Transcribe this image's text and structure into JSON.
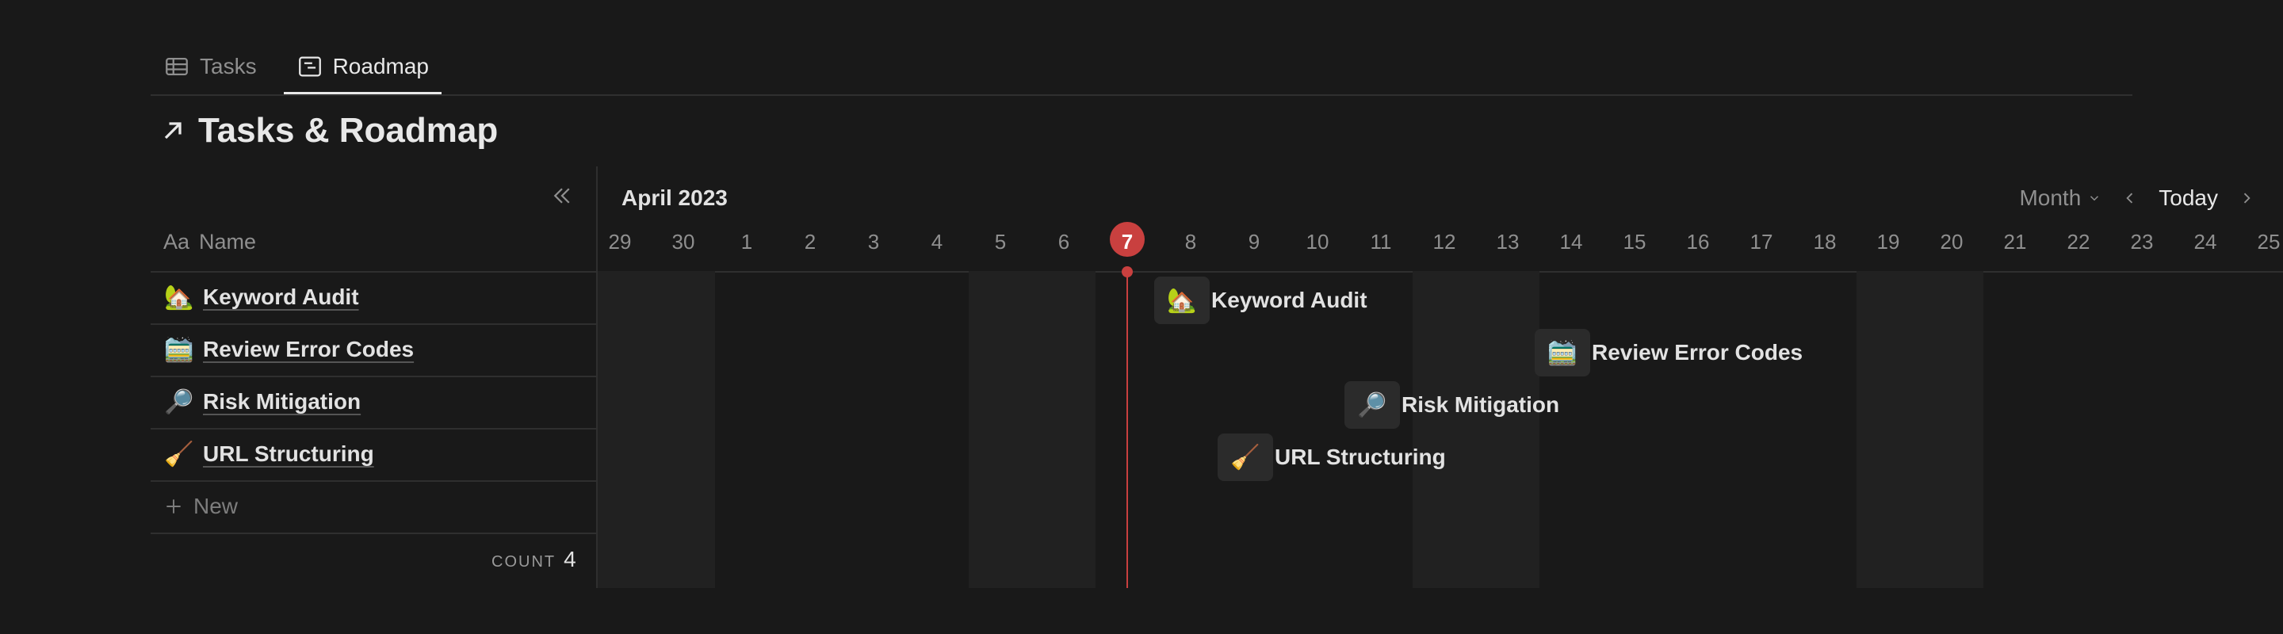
{
  "tabs": [
    {
      "label": "Tasks",
      "icon": "table-icon"
    },
    {
      "label": "Roadmap",
      "icon": "timeline-icon"
    }
  ],
  "title": "Tasks & Roadmap",
  "left_panel": {
    "column_prefix": "Aa",
    "column_header": "Name",
    "rows": [
      {
        "emoji": "🏡",
        "label": "Keyword Audit"
      },
      {
        "emoji": "🚞",
        "label": "Review Error Codes"
      },
      {
        "emoji": "🔎",
        "label": "Risk Mitigation"
      },
      {
        "emoji": "🧹",
        "label": "URL Structuring"
      }
    ],
    "new_label": "New",
    "count_label": "COUNT",
    "count_value": "4"
  },
  "timeline": {
    "month": "April 2023",
    "view": "Month",
    "today_label": "Today",
    "days": [
      "29",
      "30",
      "1",
      "2",
      "3",
      "4",
      "5",
      "6",
      "7",
      "8",
      "9",
      "10",
      "11",
      "12",
      "13",
      "14",
      "15",
      "16",
      "17",
      "18",
      "19",
      "20",
      "21",
      "22",
      "23",
      "24",
      "25"
    ],
    "today": "7",
    "bars": [
      {
        "emoji": "🏡",
        "label": "Keyword Audit",
        "start_day": "8"
      },
      {
        "emoji": "🚞",
        "label": "Review Error Codes",
        "start_day": "14"
      },
      {
        "emoji": "🔎",
        "label": "Risk Mitigation",
        "start_day": "11"
      },
      {
        "emoji": "🧹",
        "label": "URL Structuring",
        "start_day": "9"
      }
    ]
  },
  "colors": {
    "today": "#c9403f",
    "background": "#191919"
  }
}
